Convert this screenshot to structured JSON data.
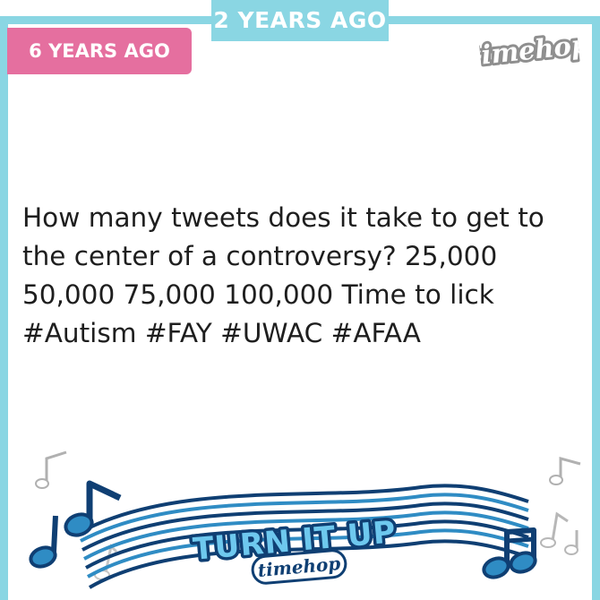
{
  "header": {
    "ago_top": "2 YEARS AGO",
    "ago_left": "6 YEARS AGO",
    "brand": "timehop"
  },
  "post": {
    "text": "How many tweets does it take to get to the center of a controversy? 25,000 50,000 75,000 100,000 Time to lick #Autism #FAY #UWAC #AFAA"
  },
  "sticker": {
    "banner": "TURN IT UP",
    "brand": "timehop"
  },
  "colors": {
    "frame": "#8ad6e3",
    "pink_tab": "#e56f9f",
    "note_blue": "#2f8cc4",
    "note_dark": "#0f3f73"
  },
  "icons": [
    "music-note-icon",
    "timehop-logo"
  ]
}
